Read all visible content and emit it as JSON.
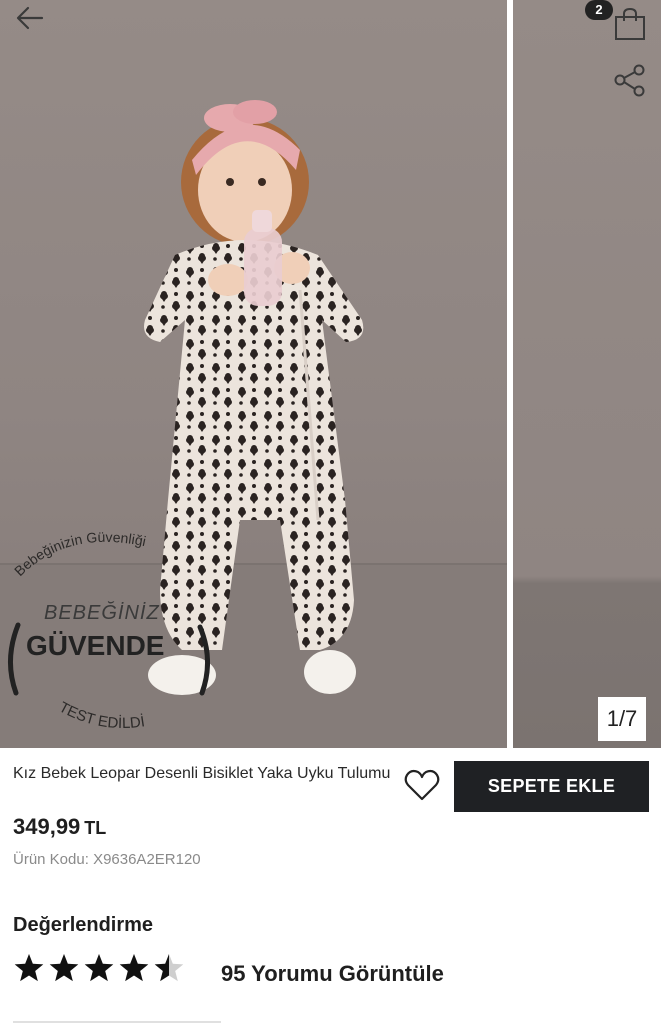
{
  "gallery": {
    "counter": "1/7",
    "cart_count": "2",
    "stamp": {
      "top_text": "Bebeğinizin Güvenliği",
      "line1": "BEBEĞİNİZ",
      "line2": "GÜVENDE",
      "bottom_text": "TEST EDİLDİ"
    }
  },
  "icons": {
    "back": "arrow-left-icon",
    "cart": "shopping-bag-icon",
    "share": "share-icon",
    "favorite": "heart-icon",
    "rating": "star-icon"
  },
  "product": {
    "title": "Kız Bebek Leopar Desenli Bisiklet Yaka Uyku Tulumu",
    "price": "349,99",
    "currency": "TL",
    "code_label": "Ürün Kodu:",
    "code_value": "X9636A2ER120",
    "add_to_cart_label": "SEPETE EKLE"
  },
  "rating": {
    "title": "Değerlendirme",
    "score": 4.5,
    "max": 5,
    "reviews_link": "95 Yorumu Görüntüle"
  },
  "colors": {
    "button_bg": "#1f2124",
    "photo_bg": "#8f8582",
    "text": "#1f1f1f",
    "muted": "#8a8a8a"
  }
}
